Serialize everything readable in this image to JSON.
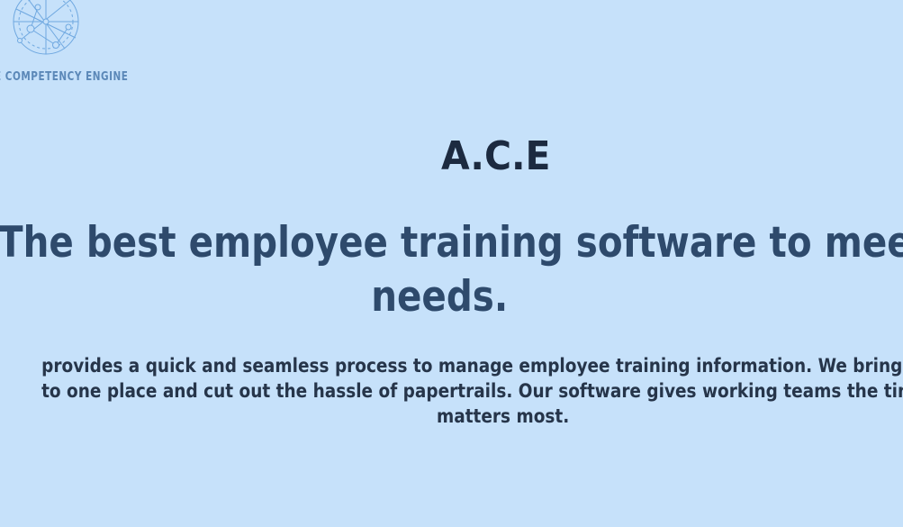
{
  "logo": {
    "text": "E COMPETENCY ENGINE",
    "icon": "network-globe-icon",
    "color": "#5b88b8"
  },
  "hero": {
    "brand": "A.C.E",
    "headline_line1": "The best employee training software to meet",
    "headline_line2": "needs.",
    "description_line1": "provides a quick and seamless process to manage employee training information. We bring your t",
    "description_line2": "to one place and cut out the hassle of papertrails. Our software gives working teams the time to f",
    "description_line3": "matters most."
  },
  "colors": {
    "background": "#c6e1fa",
    "brand_title": "#1c2a40",
    "headline": "#2e4a6c",
    "body_text": "#26354a"
  }
}
